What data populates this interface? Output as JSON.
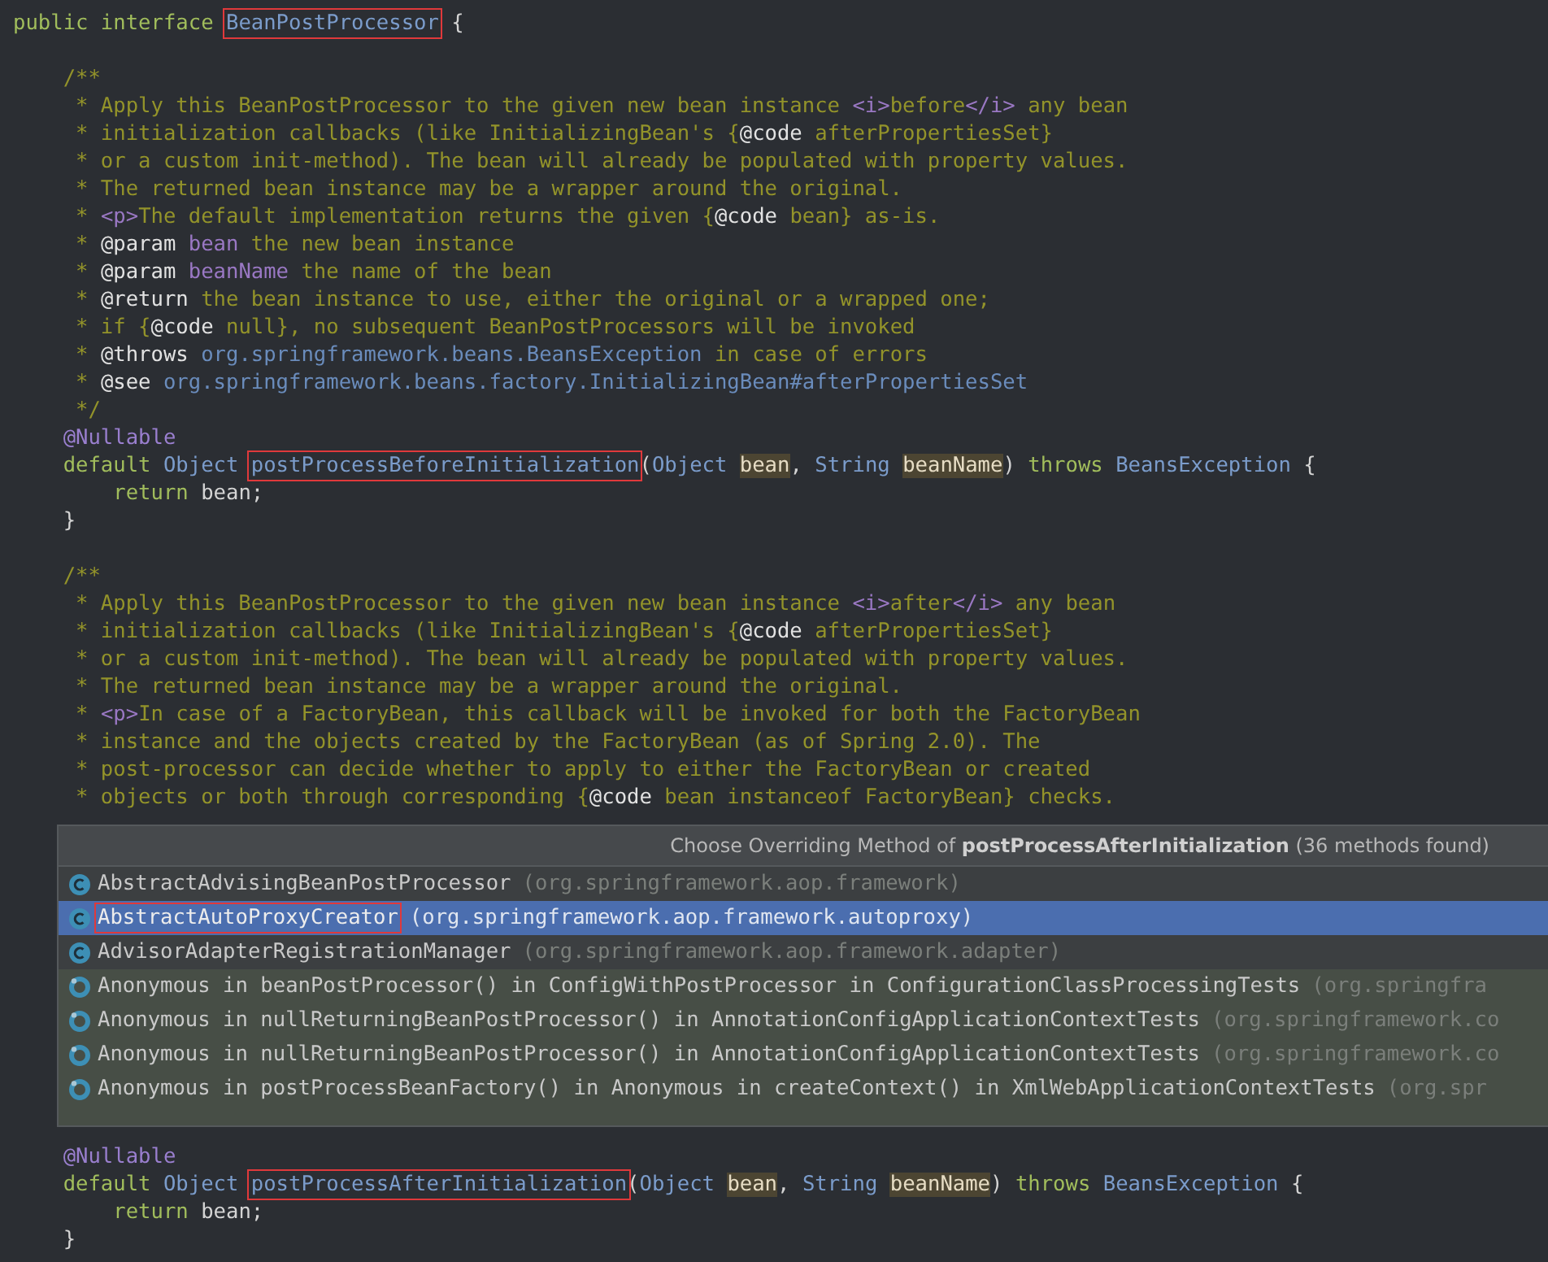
{
  "code": {
    "lines": [
      {
        "kind": "code",
        "tokens": [
          {
            "text": "public interface ",
            "kind": "keyword"
          },
          {
            "text": "BeanPostProcessor",
            "kind": "type",
            "boxed": true
          },
          {
            "text": " {",
            "kind": "plain"
          }
        ]
      },
      {
        "kind": "blank"
      },
      {
        "kind": "code",
        "tokens": [
          {
            "text": "    /**",
            "kind": "comment"
          }
        ]
      },
      {
        "kind": "code",
        "tokens": [
          {
            "text": "     * Apply this BeanPostProcessor to the given new bean instance ",
            "kind": "comment"
          },
          {
            "text": "<i>",
            "kind": "tag"
          },
          {
            "text": "before",
            "kind": "comment"
          },
          {
            "text": "</i>",
            "kind": "tag"
          },
          {
            "text": " any bean",
            "kind": "comment"
          }
        ]
      },
      {
        "kind": "code",
        "tokens": [
          {
            "text": "     * initialization callbacks (like InitializingBean's {",
            "kind": "comment"
          },
          {
            "text": "@code",
            "kind": "doctag"
          },
          {
            "text": " afterPropertiesSet}",
            "kind": "comment"
          }
        ]
      },
      {
        "kind": "code",
        "tokens": [
          {
            "text": "     * or a custom init-method). The bean will already be populated with property values.",
            "kind": "comment"
          }
        ]
      },
      {
        "kind": "code",
        "tokens": [
          {
            "text": "     * The returned bean instance may be a wrapper around the original.",
            "kind": "comment"
          }
        ]
      },
      {
        "kind": "code",
        "tokens": [
          {
            "text": "     * ",
            "kind": "comment"
          },
          {
            "text": "<p>",
            "kind": "tag"
          },
          {
            "text": "The default implementation returns the given {",
            "kind": "comment"
          },
          {
            "text": "@code",
            "kind": "doctag"
          },
          {
            "text": " bean} as-is.",
            "kind": "comment"
          }
        ]
      },
      {
        "kind": "code",
        "tokens": [
          {
            "text": "     * ",
            "kind": "comment"
          },
          {
            "text": "@param",
            "kind": "doctag"
          },
          {
            "text": " bean",
            "kind": "docparam"
          },
          {
            "text": " the new bean instance",
            "kind": "comment"
          }
        ]
      },
      {
        "kind": "code",
        "tokens": [
          {
            "text": "     * ",
            "kind": "comment"
          },
          {
            "text": "@param",
            "kind": "doctag"
          },
          {
            "text": " beanName",
            "kind": "docparam"
          },
          {
            "text": " the name of the bean",
            "kind": "comment"
          }
        ]
      },
      {
        "kind": "code",
        "tokens": [
          {
            "text": "     * ",
            "kind": "comment"
          },
          {
            "text": "@return",
            "kind": "doctag"
          },
          {
            "text": " the bean instance to use, either the original or a wrapped one;",
            "kind": "comment"
          }
        ]
      },
      {
        "kind": "code",
        "tokens": [
          {
            "text": "     * if {",
            "kind": "comment"
          },
          {
            "text": "@code",
            "kind": "doctag"
          },
          {
            "text": " null}, no subsequent BeanPostProcessors will be invoked",
            "kind": "comment"
          }
        ]
      },
      {
        "kind": "code",
        "tokens": [
          {
            "text": "     * ",
            "kind": "comment"
          },
          {
            "text": "@throws",
            "kind": "doctag"
          },
          {
            "text": " org.springframework.beans.BeansException",
            "kind": "link"
          },
          {
            "text": " in case of errors",
            "kind": "comment"
          }
        ]
      },
      {
        "kind": "code",
        "tokens": [
          {
            "text": "     * ",
            "kind": "comment"
          },
          {
            "text": "@see",
            "kind": "doctag"
          },
          {
            "text": " org.springframework.beans.factory.InitializingBean#afterPropertiesSet",
            "kind": "link"
          }
        ]
      },
      {
        "kind": "code",
        "tokens": [
          {
            "text": "     */",
            "kind": "comment"
          }
        ]
      },
      {
        "kind": "code",
        "tokens": [
          {
            "text": "    @Nullable",
            "kind": "annotation"
          }
        ]
      },
      {
        "kind": "code",
        "tokens": [
          {
            "text": "    default ",
            "kind": "keyword"
          },
          {
            "text": "Object ",
            "kind": "type"
          },
          {
            "text": "postProcessBeforeInitialization",
            "kind": "type",
            "boxed": true
          },
          {
            "text": "(",
            "kind": "plain"
          },
          {
            "text": "Object ",
            "kind": "type"
          },
          {
            "text": "bean",
            "kind": "param"
          },
          {
            "text": ", ",
            "kind": "plain"
          },
          {
            "text": "String ",
            "kind": "type"
          },
          {
            "text": "beanName",
            "kind": "param"
          },
          {
            "text": ") ",
            "kind": "plain"
          },
          {
            "text": "throws ",
            "kind": "keyword"
          },
          {
            "text": "BeansException ",
            "kind": "type"
          },
          {
            "text": "{",
            "kind": "plain"
          }
        ]
      },
      {
        "kind": "code",
        "tokens": [
          {
            "text": "        return ",
            "kind": "keyword"
          },
          {
            "text": "bean;",
            "kind": "plain"
          }
        ]
      },
      {
        "kind": "code",
        "tokens": [
          {
            "text": "    }",
            "kind": "plain"
          }
        ]
      },
      {
        "kind": "blank"
      },
      {
        "kind": "code",
        "tokens": [
          {
            "text": "    /**",
            "kind": "comment"
          }
        ]
      },
      {
        "kind": "code",
        "tokens": [
          {
            "text": "     * Apply this BeanPostProcessor to the given new bean instance ",
            "kind": "comment"
          },
          {
            "text": "<i>",
            "kind": "tag"
          },
          {
            "text": "after",
            "kind": "comment"
          },
          {
            "text": "</i>",
            "kind": "tag"
          },
          {
            "text": " any bean",
            "kind": "comment"
          }
        ]
      },
      {
        "kind": "code",
        "tokens": [
          {
            "text": "     * initialization callbacks (like InitializingBean's {",
            "kind": "comment"
          },
          {
            "text": "@code",
            "kind": "doctag"
          },
          {
            "text": " afterPropertiesSet}",
            "kind": "comment"
          }
        ]
      },
      {
        "kind": "code",
        "tokens": [
          {
            "text": "     * or a custom init-method). The bean will already be populated with property values.",
            "kind": "comment"
          }
        ]
      },
      {
        "kind": "code",
        "tokens": [
          {
            "text": "     * The returned bean instance may be a wrapper around the original.",
            "kind": "comment"
          }
        ]
      },
      {
        "kind": "code",
        "tokens": [
          {
            "text": "     * ",
            "kind": "comment"
          },
          {
            "text": "<p>",
            "kind": "tag"
          },
          {
            "text": "In case of a FactoryBean, this callback will be invoked for both the FactoryBean",
            "kind": "comment"
          }
        ]
      },
      {
        "kind": "code",
        "tokens": [
          {
            "text": "     * instance and the objects created by the FactoryBean (as of Spring 2.0). The",
            "kind": "comment"
          }
        ]
      },
      {
        "kind": "code",
        "tokens": [
          {
            "text": "     * post-processor can decide whether to apply to either the FactoryBean or created",
            "kind": "comment"
          }
        ]
      },
      {
        "kind": "code",
        "tokens": [
          {
            "text": "     * objects or both through corresponding {",
            "kind": "comment"
          },
          {
            "text": "@code",
            "kind": "doctag"
          },
          {
            "text": " bean instanceof FactoryBean} checks.",
            "kind": "comment"
          }
        ]
      },
      {
        "kind": "hidden"
      },
      {
        "kind": "code",
        "tokens": [
          {
            "text": "    @Nullable",
            "kind": "annotation"
          }
        ]
      },
      {
        "kind": "code",
        "tokens": [
          {
            "text": "    default ",
            "kind": "keyword"
          },
          {
            "text": "Object ",
            "kind": "type"
          },
          {
            "text": "postProcessAfterInitialization",
            "kind": "type",
            "boxed": true
          },
          {
            "text": "(",
            "kind": "plain"
          },
          {
            "text": "Object ",
            "kind": "type"
          },
          {
            "text": "bean",
            "kind": "param"
          },
          {
            "text": ", ",
            "kind": "plain"
          },
          {
            "text": "String ",
            "kind": "type"
          },
          {
            "text": "beanName",
            "kind": "param"
          },
          {
            "text": ") ",
            "kind": "plain"
          },
          {
            "text": "throws ",
            "kind": "keyword"
          },
          {
            "text": "BeansException ",
            "kind": "type"
          },
          {
            "text": "{",
            "kind": "plain"
          }
        ]
      },
      {
        "kind": "code",
        "tokens": [
          {
            "text": "        return ",
            "kind": "keyword"
          },
          {
            "text": "bean;",
            "kind": "plain"
          }
        ]
      },
      {
        "kind": "code",
        "tokens": [
          {
            "text": "    }",
            "kind": "plain"
          }
        ]
      }
    ]
  },
  "popup": {
    "title": "Choose Overriding Method of **postProcessAfterInitialization** (36 methods found)",
    "items": [
      {
        "kind": "class",
        "name": "AbstractAdvisingBeanPostProcessor",
        "package": "(org.springframework.aop.framework)",
        "selected": false,
        "test": false,
        "boxed": false
      },
      {
        "kind": "class",
        "name": "AbstractAutoProxyCreator",
        "package": "(org.springframework.aop.framework.autoproxy)",
        "selected": true,
        "test": false,
        "boxed": true
      },
      {
        "kind": "class",
        "name": "AdvisorAdapterRegistrationManager",
        "package": "(org.springframework.aop.framework.adapter)",
        "selected": false,
        "test": false,
        "boxed": false
      },
      {
        "kind": "anonymous",
        "name": "Anonymous in beanPostProcessor() in ConfigWithPostProcessor in ConfigurationClassProcessingTests",
        "package": "(org.springfra",
        "selected": false,
        "test": true,
        "boxed": false
      },
      {
        "kind": "anonymous",
        "name": "Anonymous in nullReturningBeanPostProcessor() in AnnotationConfigApplicationContextTests",
        "package": "(org.springframework.co",
        "selected": false,
        "test": true,
        "boxed": false
      },
      {
        "kind": "anonymous",
        "name": "Anonymous in nullReturningBeanPostProcessor() in AnnotationConfigApplicationContextTests",
        "package": "(org.springframework.co",
        "selected": false,
        "test": true,
        "boxed": false
      },
      {
        "kind": "anonymous",
        "name": "Anonymous in postProcessBeanFactory() in Anonymous in createContext() in XmlWebApplicationContextTests",
        "package": "(org.spr",
        "selected": false,
        "test": true,
        "boxed": false
      }
    ]
  }
}
